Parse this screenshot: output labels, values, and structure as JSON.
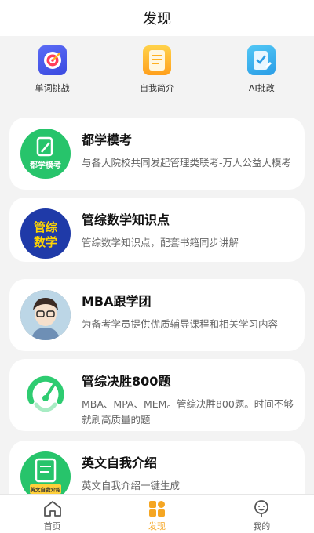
{
  "header": {
    "title": "发现"
  },
  "quick_actions": [
    {
      "label": "单词挑战",
      "icon": "target-icon"
    },
    {
      "label": "自我简介",
      "icon": "document-icon"
    },
    {
      "label": "AI批改",
      "icon": "pen-check-icon"
    }
  ],
  "cards": [
    {
      "title": "都学模考",
      "desc": "与各大院校共同发起管理类联考-万人公益大模考",
      "thumb_text": "都学模考",
      "thumb_color": "#2ecc71"
    },
    {
      "title": "管综数学知识点",
      "desc": "管综数学知识点，配套书籍同步讲解",
      "thumb_text_1": "管综",
      "thumb_text_2": "数学",
      "thumb_color": "#1f3aa8"
    },
    {
      "title": "MBA跟学团",
      "desc": "为备考学员提供优质辅导课程和相关学习内容",
      "thumb_color": "#7c7c7c"
    },
    {
      "title": "管综决胜800题",
      "desc": "MBA、MPA、MEM。管综决胜800题。时间不够就刷高质量的题",
      "thumb_color": "#2ecc71"
    },
    {
      "title": "英文自我介绍",
      "desc": "英文自我介绍一键生成",
      "thumb_text": "英文自我介绍",
      "thumb_color": "#2ecc71"
    }
  ],
  "tabbar": {
    "items": [
      {
        "label": "首页",
        "icon": "home-icon",
        "active": false
      },
      {
        "label": "发现",
        "icon": "discover-icon",
        "active": true
      },
      {
        "label": "我的",
        "icon": "profile-icon",
        "active": false
      }
    ],
    "active_color": "#f5a623"
  }
}
